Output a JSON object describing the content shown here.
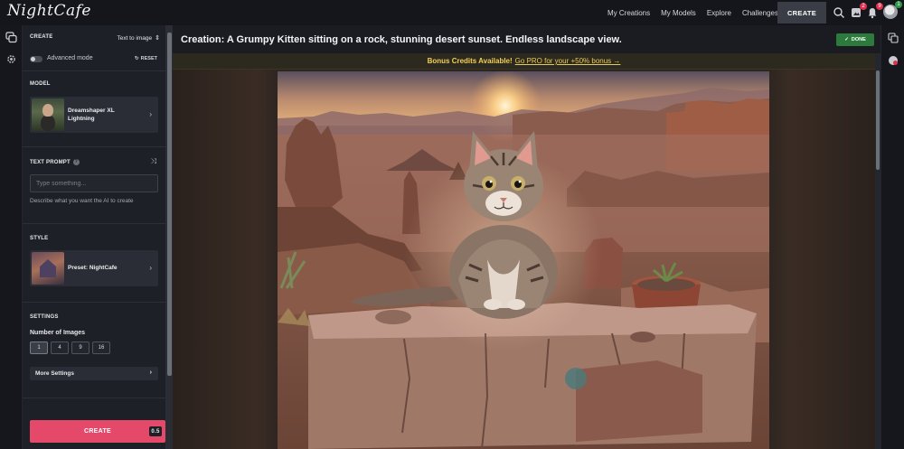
{
  "app": {
    "logo_text": "NightCafe"
  },
  "nav": {
    "links": [
      "My Creations",
      "My Models",
      "Explore",
      "Challenges"
    ],
    "create_label": "CREATE",
    "badges": {
      "gallery": "2",
      "notifications": "9",
      "profile": "1"
    }
  },
  "panel": {
    "create_label": "CREATE",
    "mode": "Text to image",
    "advanced_mode_label": "Advanced mode",
    "reset_label": "RESET",
    "model_section": "MODEL",
    "model_name": "Dreamshaper XL Lightning",
    "text_prompt_section": "TEXT PROMPT",
    "prompt_help_icon": "?",
    "prompt_placeholder": "Type something...",
    "prompt_value": "",
    "prompt_help": "Describe what you want the AI to create",
    "style_section": "STYLE",
    "style_name": "Preset: NightCafe",
    "settings_section": "SETTINGS",
    "number_of_images_label": "Number of Images",
    "number_of_images_options": [
      "1",
      "4",
      "9",
      "16"
    ],
    "number_of_images_selected": "1",
    "more_settings_label": "More Settings",
    "create_button_label": "CREATE",
    "create_cost": "0.5"
  },
  "creation": {
    "title": "Creation: A Grumpy Kitten sitting on a rock, stunning desert sunset. Endless landscape view.",
    "done_label": "DONE"
  },
  "bonus": {
    "highlight": "Bonus Credits Available!",
    "link_text": "Go PRO for your +50% bonus →"
  },
  "colors": {
    "accent_create": "#e5496a",
    "done_green": "#2c7a3c",
    "bonus_yellow": "#e9c95a"
  }
}
